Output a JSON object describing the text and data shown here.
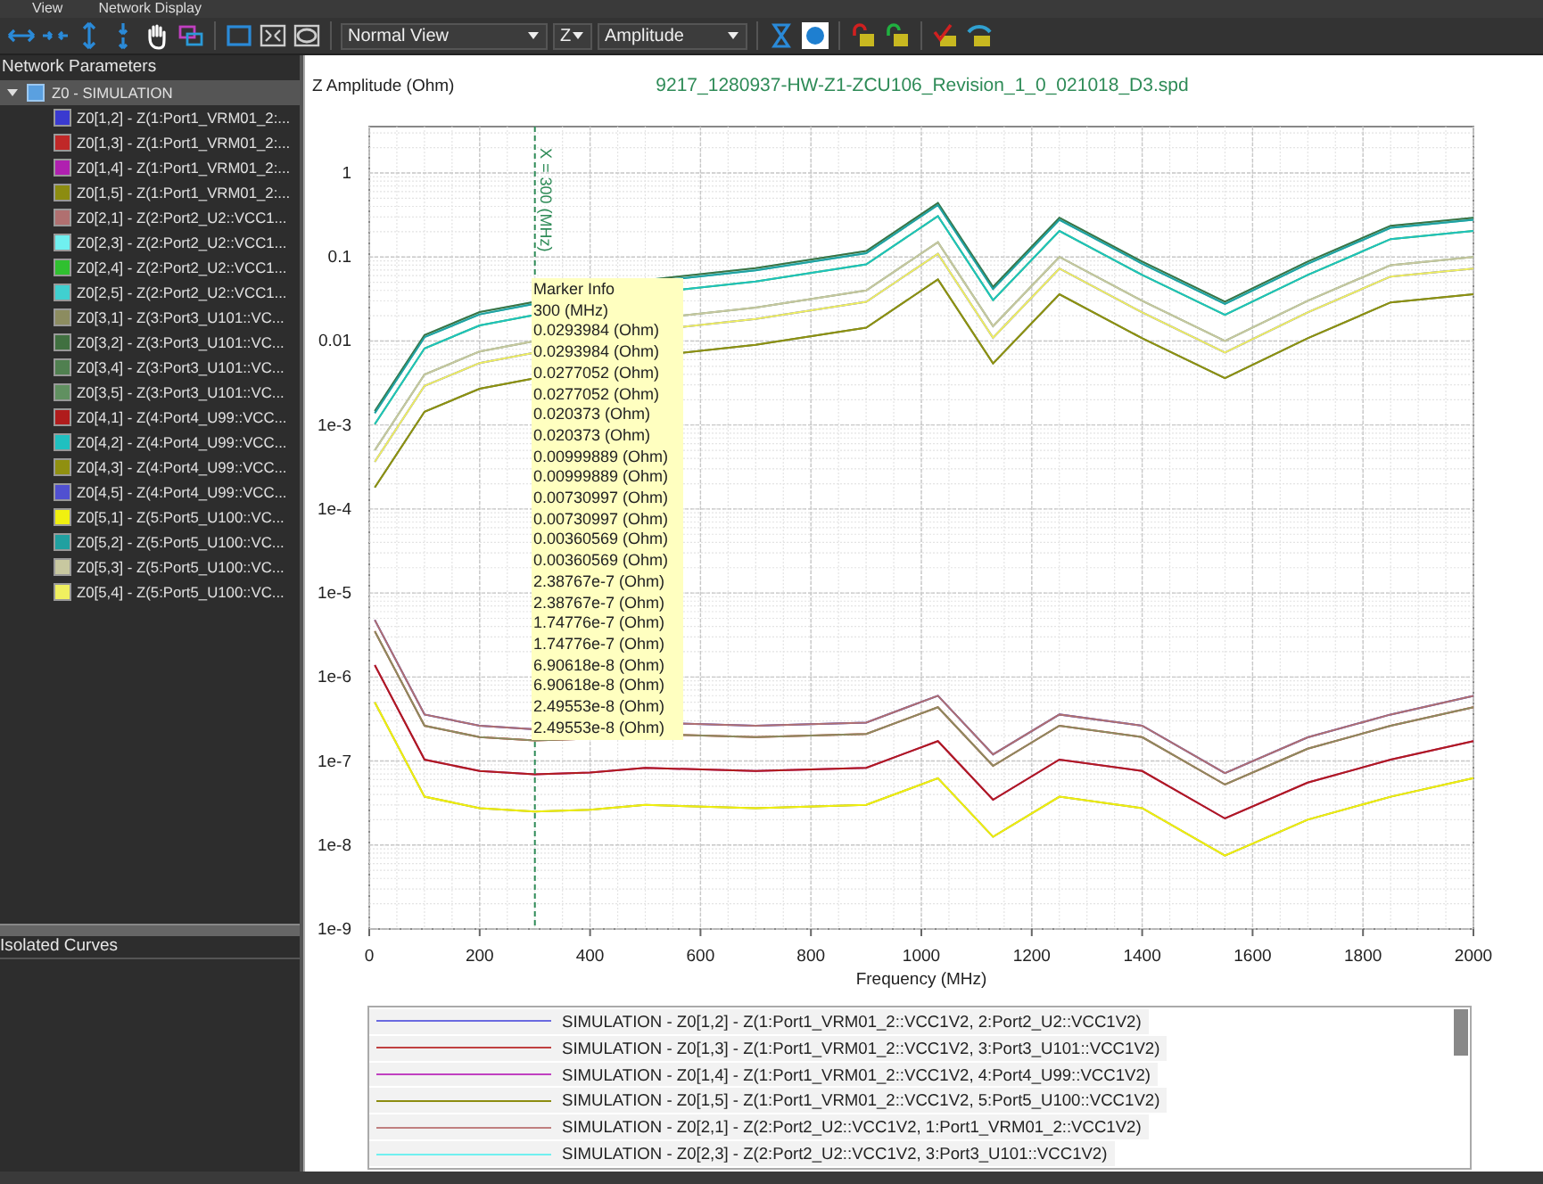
{
  "tabs": [
    "View",
    "Network Display"
  ],
  "toolbar": {
    "view_mode": "Normal View",
    "parameter": "Z",
    "display": "Amplitude"
  },
  "sidebar": {
    "title": "Network Parameters",
    "tree": {
      "label": "Z0 - SIMULATION",
      "expanded": true,
      "selected": true,
      "children": [
        {
          "label": "Z0[1,2] - Z(1:Port1_VRM01_2:...",
          "color": "#3a3ad0"
        },
        {
          "label": "Z0[1,3] - Z(1:Port1_VRM01_2:...",
          "color": "#c02828"
        },
        {
          "label": "Z0[1,4] - Z(1:Port1_VRM01_2:...",
          "color": "#b020b0"
        },
        {
          "label": "Z0[1,5] - Z(1:Port1_VRM01_2:...",
          "color": "#8c8c10"
        },
        {
          "label": "Z0[2,1] - Z(2:Port2_U2::VCC1...",
          "color": "#b07070"
        },
        {
          "label": "Z0[2,3] - Z(2:Port2_U2::VCC1...",
          "color": "#70f0f0"
        },
        {
          "label": "Z0[2,4] - Z(2:Port2_U2::VCC1...",
          "color": "#30c030"
        },
        {
          "label": "Z0[2,5] - Z(2:Port2_U2::VCC1...",
          "color": "#40d0d0"
        },
        {
          "label": "Z0[3,1] - Z(3:Port3_U101::VC...",
          "color": "#8c8c60"
        },
        {
          "label": "Z0[3,2] - Z(3:Port3_U101::VC...",
          "color": "#407040"
        },
        {
          "label": "Z0[3,4] - Z(3:Port3_U101::VC...",
          "color": "#508050"
        },
        {
          "label": "Z0[3,5] - Z(3:Port3_U101::VC...",
          "color": "#609060"
        },
        {
          "label": "Z0[4,1] - Z(4:Port4_U99::VCC...",
          "color": "#b01c1c"
        },
        {
          "label": "Z0[4,2] - Z(4:Port4_U99::VCC...",
          "color": "#20c0c0"
        },
        {
          "label": "Z0[4,3] - Z(4:Port4_U99::VCC...",
          "color": "#909010"
        },
        {
          "label": "Z0[4,5] - Z(4:Port4_U99::VCC...",
          "color": "#5050d0"
        },
        {
          "label": "Z0[5,1] - Z(5:Port5_U100::VC...",
          "color": "#f0f010"
        },
        {
          "label": "Z0[5,2] - Z(5:Port5_U100::VC...",
          "color": "#20a0a0"
        },
        {
          "label": "Z0[5,3] - Z(5:Port5_U100::VC...",
          "color": "#c8c8a0"
        },
        {
          "label": "Z0[5,4] - Z(5:Port5_U100::VC...",
          "color": "#f0f060"
        }
      ]
    }
  },
  "isolated_panel": {
    "title": "Isolated Curves"
  },
  "plot": {
    "title": "9217_1280937-HW-Z1-ZCU106_Revision_1_0_021018_D3.spd",
    "y_axis_title": "Z Amplitude (Ohm)",
    "x_axis_title": "Frequency (MHz)",
    "x_tick_labels": [
      "0",
      "200",
      "400",
      "600",
      "800",
      "1000",
      "1200",
      "1400",
      "1600",
      "1800",
      "2000"
    ],
    "y_tick_labels": [
      "1",
      "0.1",
      "0.01",
      "1e-3",
      "1e-4",
      "1e-5",
      "1e-6",
      "1e-7",
      "1e-8",
      "1e-9"
    ],
    "marker_label": "X = 300 (MHz)",
    "marker_info": {
      "title": "Marker Info",
      "lines": [
        "300 (MHz)",
        "0.0293984 (Ohm)",
        "0.0293984 (Ohm)",
        "0.0277052 (Ohm)",
        "0.0277052 (Ohm)",
        "0.020373 (Ohm)",
        "0.020373 (Ohm)",
        "0.00999889 (Ohm)",
        "0.00999889 (Ohm)",
        "0.00730997 (Ohm)",
        "0.00730997 (Ohm)",
        "0.00360569 (Ohm)",
        "0.00360569 (Ohm)",
        "2.38767e-7 (Ohm)",
        "2.38767e-7 (Ohm)",
        "1.74776e-7 (Ohm)",
        "1.74776e-7 (Ohm)",
        "6.90618e-8 (Ohm)",
        "6.90618e-8 (Ohm)",
        "2.49553e-8 (Ohm)",
        "2.49553e-8 (Ohm)"
      ]
    }
  },
  "legend": [
    {
      "label": "SIMULATION - Z0[1,2] - Z(1:Port1_VRM01_2::VCC1V2, 2:Port2_U2::VCC1V2)",
      "color": "#6a6ae0"
    },
    {
      "label": "SIMULATION - Z0[1,3] - Z(1:Port1_VRM01_2::VCC1V2, 3:Port3_U101::VCC1V2)",
      "color": "#c04040"
    },
    {
      "label": "SIMULATION - Z0[1,4] - Z(1:Port1_VRM01_2::VCC1V2, 4:Port4_U99::VCC1V2)",
      "color": "#c040c0"
    },
    {
      "label": "SIMULATION - Z0[1,5] - Z(1:Port1_VRM01_2::VCC1V2, 5:Port5_U100::VCC1V2)",
      "color": "#8c8c10"
    },
    {
      "label": "SIMULATION - Z0[2,1] - Z(2:Port2_U2::VCC1V2, 1:Port1_VRM01_2::VCC1V2)",
      "color": "#c08080"
    },
    {
      "label": "SIMULATION - Z0[2,3] - Z(2:Port2_U2::VCC1V2, 3:Port3_U101::VCC1V2)",
      "color": "#70f0f0"
    }
  ]
}
